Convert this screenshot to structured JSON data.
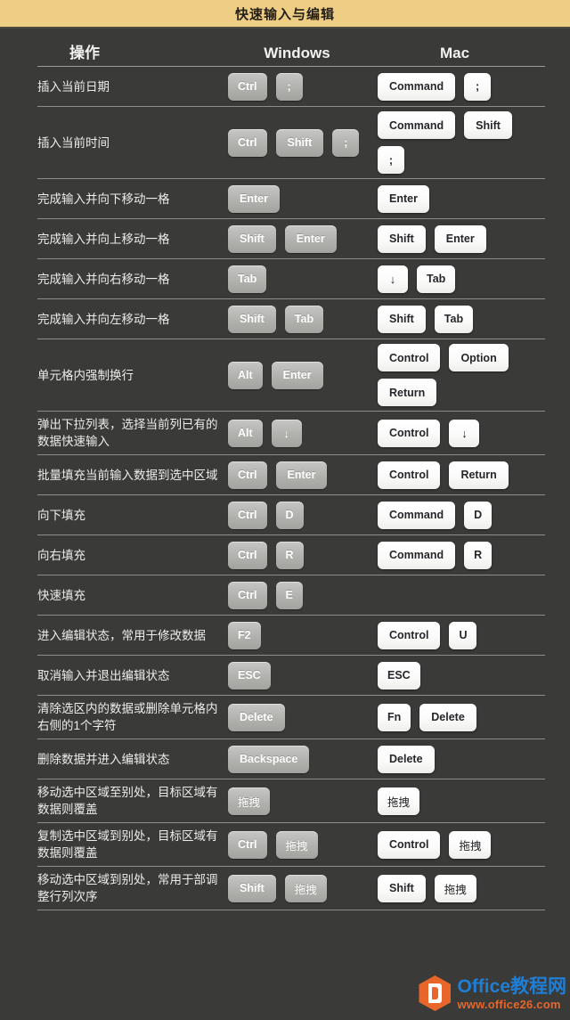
{
  "banner": {
    "title": "快速输入与编辑"
  },
  "table": {
    "headers": {
      "action": "操作",
      "windows": "Windows",
      "mac": "Mac"
    },
    "rows": [
      {
        "action": "插入当前日期",
        "windows": [
          "Ctrl",
          ";"
        ],
        "mac": [
          "Command",
          ";"
        ]
      },
      {
        "action": "插入当前时间",
        "windows": [
          "Ctrl",
          "Shift",
          ";"
        ],
        "mac": [
          "Command",
          "Shift",
          ";"
        ]
      },
      {
        "action": "完成输入并向下移动一格",
        "windows": [
          "Enter"
        ],
        "mac": [
          "Enter"
        ]
      },
      {
        "action": "完成输入并向上移动一格",
        "windows": [
          "Shift",
          "Enter"
        ],
        "mac": [
          "Shift",
          "Enter"
        ]
      },
      {
        "action": "完成输入并向右移动一格",
        "windows": [
          "Tab"
        ],
        "mac": [
          "↓",
          "Tab"
        ]
      },
      {
        "action": "完成输入并向左移动一格",
        "windows": [
          "Shift",
          "Tab"
        ],
        "mac": [
          "Shift",
          "Tab"
        ]
      },
      {
        "action": "单元格内强制换行",
        "windows": [
          "Alt",
          "Enter"
        ],
        "mac": [
          "Control",
          "Option",
          "Return"
        ]
      },
      {
        "action": "弹出下拉列表，选择当前列已有的数据快速输入",
        "windows": [
          "Alt",
          "↓"
        ],
        "mac": [
          "Control",
          "↓"
        ]
      },
      {
        "action": "批量填充当前输入数据到选中区域",
        "windows": [
          "Ctrl",
          "Enter"
        ],
        "mac": [
          "Control",
          "Return"
        ]
      },
      {
        "action": "向下填充",
        "windows": [
          "Ctrl",
          "D"
        ],
        "mac": [
          "Command",
          "D"
        ]
      },
      {
        "action": "向右填充",
        "windows": [
          "Ctrl",
          "R"
        ],
        "mac": [
          "Command",
          "R"
        ]
      },
      {
        "action": "快速填充",
        "windows": [
          "Ctrl",
          "E"
        ],
        "mac": []
      },
      {
        "action": "进入编辑状态，常用于修改数据",
        "windows": [
          "F2"
        ],
        "mac": [
          "Control",
          "U"
        ]
      },
      {
        "action": "取消输入并退出编辑状态",
        "windows": [
          "ESC"
        ],
        "mac": [
          "ESC"
        ]
      },
      {
        "action": "清除选区内的数据或删除单元格内右侧的1个字符",
        "windows": [
          "Delete"
        ],
        "mac": [
          "Fn",
          "Delete"
        ]
      },
      {
        "action": "删除数据并进入编辑状态",
        "windows": [
          "Backspace"
        ],
        "mac": [
          "Delete"
        ]
      },
      {
        "action": "移动选中区域至别处，目标区域有数据则覆盖",
        "windows": [
          "拖拽"
        ],
        "mac": [
          "拖拽"
        ]
      },
      {
        "action": "复制选中区域到别处，目标区域有数据则覆盖",
        "windows": [
          "Ctrl",
          "拖拽"
        ],
        "mac": [
          "Control",
          "拖拽"
        ]
      },
      {
        "action": "移动选中区域到别处，常用于部调整行列次序",
        "windows": [
          "Shift",
          "拖拽"
        ],
        "mac": [
          "Shift",
          "拖拽"
        ]
      }
    ]
  },
  "watermark": {
    "logo": "office-logo-icon",
    "title": "Office教程网",
    "url": "www.office26.com"
  },
  "colors": {
    "banner_bg": "#eecd85",
    "page_bg": "#3a3a38",
    "divider": "#8e8e88",
    "win_key": "#b2b2af",
    "mac_key": "#ffffff",
    "brand_blue": "#1f7fd6",
    "brand_orange": "#e8662a"
  }
}
